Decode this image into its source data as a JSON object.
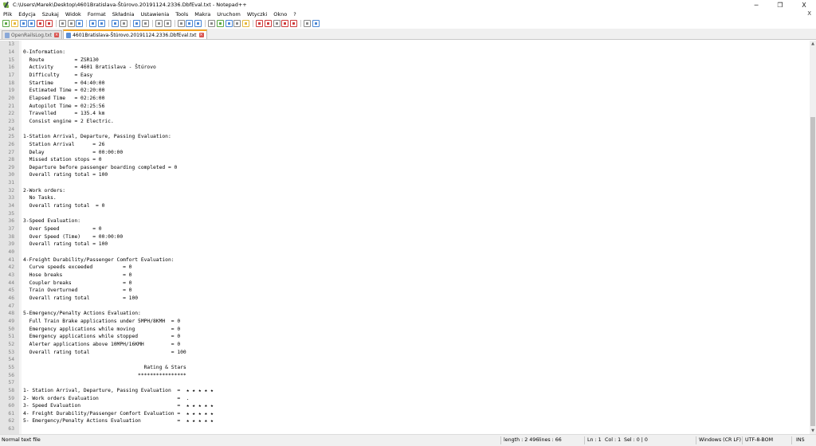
{
  "window": {
    "title": "C:\\Users\\Marek\\Desktop\\4601Bratislava-Štúrovo.20191124.2336.DbfEval.txt - Notepad++",
    "minimize": "─",
    "maximize": "❐",
    "close": "X"
  },
  "menu": {
    "items": [
      "Plik",
      "Edycja",
      "Szukaj",
      "Widok",
      "Format",
      "Składnia",
      "Ustawienia",
      "Tools",
      "Makra",
      "Uruchom",
      "Wtyczki",
      "Okno",
      "?"
    ],
    "close": "X"
  },
  "toolbar": {
    "icons": [
      "new-file-icon",
      "open-file-icon",
      "save-icon",
      "save-all-icon",
      "close-file-icon",
      "close-all-icon",
      "print-icon",
      "cut-icon",
      "copy-icon",
      "paste-icon",
      "undo-icon",
      "redo-icon",
      "find-icon",
      "replace-icon",
      "zoom-in-icon",
      "zoom-out-icon",
      "sync-vertical-icon",
      "sync-horizontal-icon",
      "word-wrap-icon",
      "show-all-chars-icon",
      "indent-guide-icon",
      "user-language-icon",
      "doc-map-icon",
      "function-list-icon",
      "folder-workspace-icon",
      "monitoring-icon",
      "record-macro-icon",
      "stop-macro-icon",
      "play-macro-icon",
      "run-macro-multiple-icon",
      "save-macro-icon",
      "spell-check-icon"
    ],
    "colors": {
      "green": "#5aa745",
      "blue": "#4a86d4",
      "yellow": "#e5b83b",
      "red": "#cf3b3b",
      "gray": "#8a8a8a"
    }
  },
  "tabs": [
    {
      "label": "OpenRailsLog.txt",
      "active": false
    },
    {
      "label": "4601Bratislava-Štúrovo.20191124.2336.DbfEval.txt",
      "active": true
    }
  ],
  "editor": {
    "lines": [
      {
        "n": "13",
        "t": ""
      },
      {
        "n": "14",
        "t": "0-Information:"
      },
      {
        "n": "15",
        "t": "  Route          = ZSR130"
      },
      {
        "n": "16",
        "t": "  Activity       = 4601 Bratislava - Štúrovo"
      },
      {
        "n": "17",
        "t": "  Difficulty     = Easy"
      },
      {
        "n": "18",
        "t": "  Startime       = 04:40:00"
      },
      {
        "n": "19",
        "t": "  Estimated Time = 02:20:00"
      },
      {
        "n": "20",
        "t": "  Elapsed Time   = 02:26:00"
      },
      {
        "n": "21",
        "t": "  Autopilot Time = 02:25:56"
      },
      {
        "n": "22",
        "t": "  Travelled      = 135.4 km"
      },
      {
        "n": "23",
        "t": "  Consist engine = 2 Electric."
      },
      {
        "n": "24",
        "t": ""
      },
      {
        "n": "25",
        "t": "1-Station Arrival, Departure, Passing Evaluation:"
      },
      {
        "n": "26",
        "t": "  Station Arrival      = 26"
      },
      {
        "n": "27",
        "t": "  Delay                = 00:00:00"
      },
      {
        "n": "28",
        "t": "  Missed station stops = 0"
      },
      {
        "n": "29",
        "t": "  Departure before passenger boarding completed = 0"
      },
      {
        "n": "30",
        "t": "  Overall rating total = 100"
      },
      {
        "n": "31",
        "t": ""
      },
      {
        "n": "32",
        "t": "2-Work orders:"
      },
      {
        "n": "33",
        "t": "  No Tasks."
      },
      {
        "n": "34",
        "t": "  Overall rating total  = 0"
      },
      {
        "n": "35",
        "t": ""
      },
      {
        "n": "36",
        "t": "3-Speed Evaluation:"
      },
      {
        "n": "37",
        "t": "  Over Speed           = 0"
      },
      {
        "n": "38",
        "t": "  Over Speed (Time)    = 00:00:00"
      },
      {
        "n": "39",
        "t": "  Overall rating total = 100"
      },
      {
        "n": "40",
        "t": ""
      },
      {
        "n": "41",
        "t": "4-Freight Durability/Passenger Comfort Evaluation:"
      },
      {
        "n": "42",
        "t": "  Curve speeds exceeded          = 0"
      },
      {
        "n": "43",
        "t": "  Hose breaks                    = 0"
      },
      {
        "n": "44",
        "t": "  Coupler breaks                 = 0"
      },
      {
        "n": "45",
        "t": "  Train Overturned               = 0"
      },
      {
        "n": "46",
        "t": "  Overall rating total           = 100"
      },
      {
        "n": "47",
        "t": ""
      },
      {
        "n": "48",
        "t": "5-Emergency/Penalty Actions Evaluation:"
      },
      {
        "n": "49",
        "t": "  Full Train Brake applications under 5MPH/8KMH  = 0"
      },
      {
        "n": "50",
        "t": "  Emergency applications while moving            = 0"
      },
      {
        "n": "51",
        "t": "  Emergency applications while stopped           = 0"
      },
      {
        "n": "52",
        "t": "  Alerter applications above 10MPH/16KMH         = 0"
      },
      {
        "n": "53",
        "t": "  Overall rating total                           = 100"
      },
      {
        "n": "54",
        "t": ""
      },
      {
        "n": "55",
        "t": "                                        Rating & Stars"
      },
      {
        "n": "56",
        "t": "                                      ****************"
      },
      {
        "n": "57",
        "t": ""
      },
      {
        "n": "58",
        "t": "1- Station Arrival, Departure, Passing Evaluation  =  ★ ★ ★ ★ ★"
      },
      {
        "n": "59",
        "t": "2- Work orders Evaluation                          =  ."
      },
      {
        "n": "60",
        "t": "3- Speed Evaluation                                =  ★ ★ ★ ★ ★"
      },
      {
        "n": "61",
        "t": "4- Freight Durability/Passenger Comfort Evaluation =  ★ ★ ★ ★ ★"
      },
      {
        "n": "62",
        "t": "5- Emergency/Penalty Actions Evaluation            =  ★ ★ ★ ★ ★"
      },
      {
        "n": "63",
        "t": ""
      }
    ]
  },
  "status": {
    "file_type": "Normal text file",
    "length": "length : 2 496",
    "lines": "lines : 66",
    "ln": "Ln : 1",
    "col": "Col : 1",
    "sel": "Sel : 0 | 0",
    "eol": "Windows (CR LF)",
    "encoding": "UTF-8-BOM",
    "mode": "INS"
  }
}
